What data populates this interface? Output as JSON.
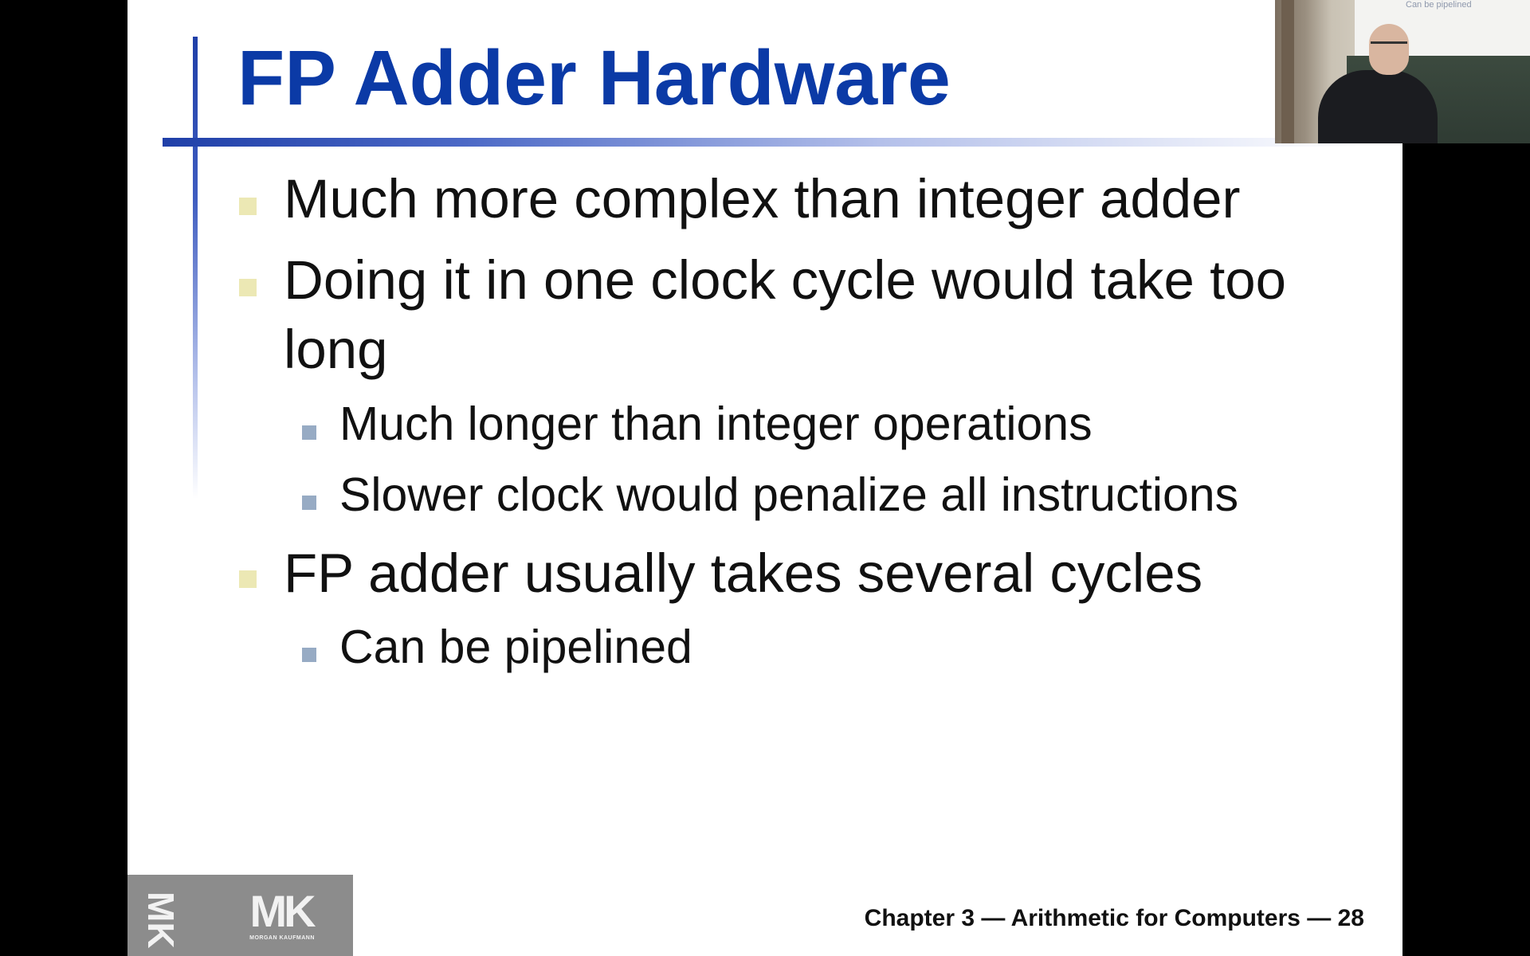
{
  "slide": {
    "title": "FP Adder Hardware",
    "bullets": [
      {
        "level": 1,
        "text": "Much more complex than integer adder"
      },
      {
        "level": 1,
        "text": "Doing it in one clock cycle would take too long"
      },
      {
        "level": 2,
        "text": "Much longer than integer operations"
      },
      {
        "level": 2,
        "text": "Slower clock would penalize all instructions"
      },
      {
        "level": 1,
        "text": "FP adder usually takes several cycles"
      },
      {
        "level": 2,
        "text": "Can be pipelined"
      }
    ],
    "footer": "Chapter 3 — Arithmetic for Computers — 28",
    "logo": {
      "side_mark": "MK",
      "main_mark": "MK",
      "publisher": "MORGAN KAUFMANN"
    }
  },
  "webcam": {
    "screen_text": "Can be pipelined"
  },
  "colors": {
    "title": "#0b3aa6",
    "accent_rule": "#1f3fa8",
    "bullet_level1": "#ece8b4",
    "bullet_level2": "#97abc4",
    "logo_bg": "#8c8c8c"
  }
}
